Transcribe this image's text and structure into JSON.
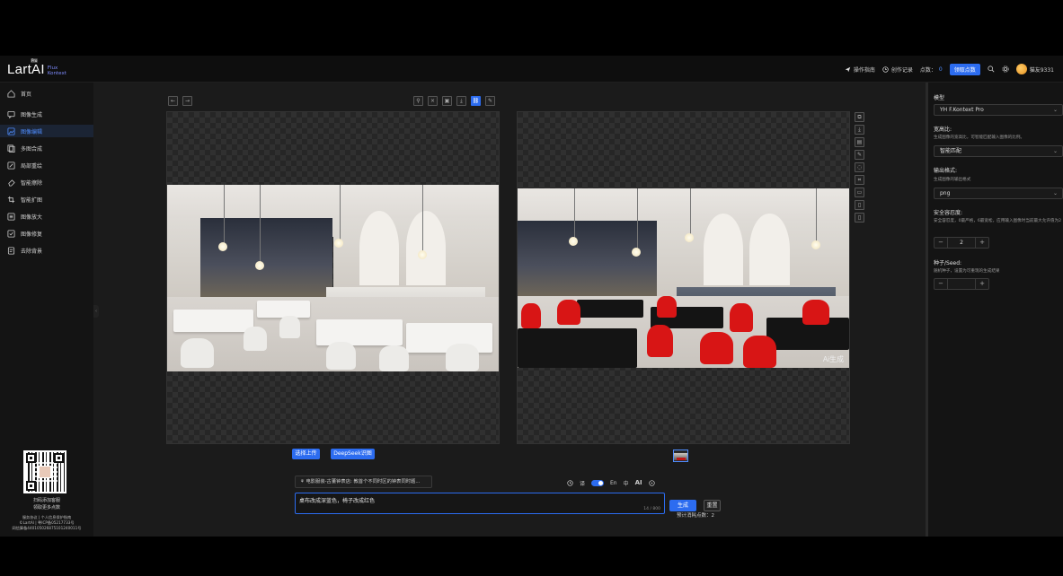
{
  "header": {
    "logo_main": "LartAI",
    "logo_badge": "Pro",
    "logo_sub1": "Flux",
    "logo_sub2": "Kontext",
    "guide": "操作指南",
    "history": "创作记录",
    "points_label": "点数：",
    "points_value": "0",
    "claim_points": "领取点数",
    "username": "猫友9331"
  },
  "sidebar": {
    "items": [
      {
        "label": "首页",
        "icon": "home-icon"
      },
      {
        "label": "图像生成",
        "icon": "chat-icon"
      },
      {
        "label": "图像编辑",
        "icon": "image-edit-icon"
      },
      {
        "label": "多图合成",
        "icon": "layers-icon"
      },
      {
        "label": "局部重绘",
        "icon": "brush-icon"
      },
      {
        "label": "智能擦除",
        "icon": "eraser-icon"
      },
      {
        "label": "智能扩图",
        "icon": "crop-icon"
      },
      {
        "label": "图像放大",
        "icon": "zoom-icon"
      },
      {
        "label": "图像修复",
        "icon": "repair-icon"
      },
      {
        "label": "去除背景",
        "icon": "remove-bg-icon"
      }
    ],
    "active_index": 2,
    "qr_caption1": "扫码添加客服",
    "qr_caption2": "领取更多点数",
    "footer1": "服务协议 | 个人信息保护指南",
    "footer2": "©LartAI | 粤ICP备05217733号",
    "footer3": "网信算备440105026875101240011号"
  },
  "editor": {
    "upload_button": "选择上传",
    "deepseek_button": "DeepSeek识图",
    "prompt_hint": "电影服装-古董钟表店: 教首个不同时区的钟表同时题...",
    "prompt_text": "桌布改成深蓝色，椅子改成红色",
    "char_count": "14 / 800",
    "translate_label": "译",
    "lang_en": "En",
    "lang_zh": "中",
    "ai_label": "AI",
    "generate_button": "生成",
    "reset_button": "重置",
    "estimate_label": "预计消耗点数：",
    "estimate_value": "2",
    "watermark": "Ai生成"
  },
  "settings": {
    "model_label": "模型",
    "model_value": "YH F.Kontext Pro",
    "ratio_label": "宽高比:",
    "ratio_desc": "生成图像的宽高比，可智能匹配输入图像的比例。",
    "ratio_value": "智能匹配",
    "format_label": "输出格式:",
    "format_desc": "生成图像的输出格式",
    "format_value": "png",
    "safety_label": "安全容忍度:",
    "safety_desc": "安全容忍度，0最严格，6最宽松，应用输入图像时当前最大允许值为2",
    "safety_value": "2",
    "seed_label": "种子/Seed:",
    "seed_desc": "随机种子，设置为可重现的生成结果",
    "seed_value": ""
  },
  "colors": {
    "accent": "#2c6cf0",
    "background": "#1b1b1b",
    "sidebar_active": "#1b2434"
  }
}
